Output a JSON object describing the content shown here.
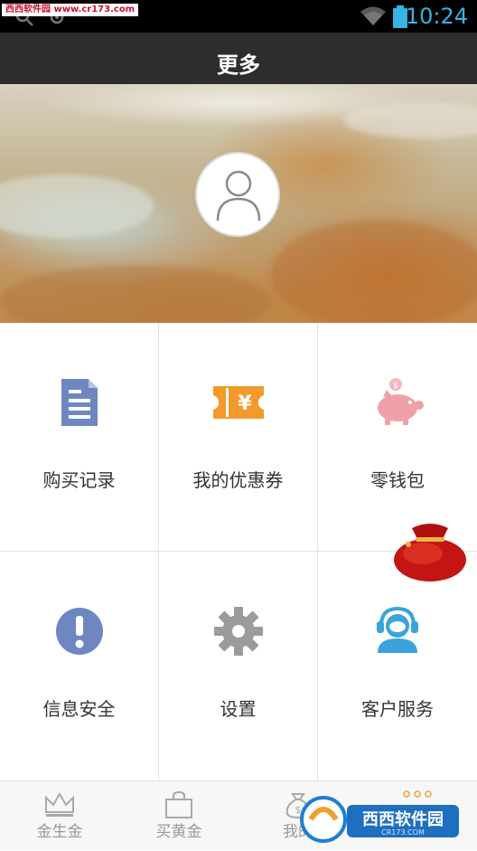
{
  "status_bar": {
    "watermark": "西西软件园 www.cr173.com",
    "time": "10:24",
    "icon_color": "#33b5e5"
  },
  "header": {
    "title": "更多"
  },
  "menu": {
    "items": [
      {
        "label": "购买记录",
        "icon": "document-icon",
        "color": "#6f87c0"
      },
      {
        "label": "我的优惠券",
        "icon": "coupon-icon",
        "color": "#f39a2b"
      },
      {
        "label": "零钱包",
        "icon": "piggy-bank-icon",
        "color": "#f0a0a8"
      },
      {
        "label": "信息安全",
        "icon": "alert-icon",
        "color": "#6f87c0"
      },
      {
        "label": "设置",
        "icon": "gear-icon",
        "color": "#9b9b9b"
      },
      {
        "label": "客户服务",
        "icon": "headset-icon",
        "color": "#3aa3dc"
      }
    ]
  },
  "bottom_nav": {
    "items": [
      {
        "label": "金生金",
        "icon": "crown-icon"
      },
      {
        "label": "买黄金",
        "icon": "shopping-bag-icon"
      },
      {
        "label": "我的",
        "icon": "money-bag-icon"
      },
      {
        "label": "",
        "icon": "more-icon"
      }
    ]
  },
  "watermark_bottom": {
    "text": "西西软件园",
    "subtext": "CR173.COM"
  }
}
